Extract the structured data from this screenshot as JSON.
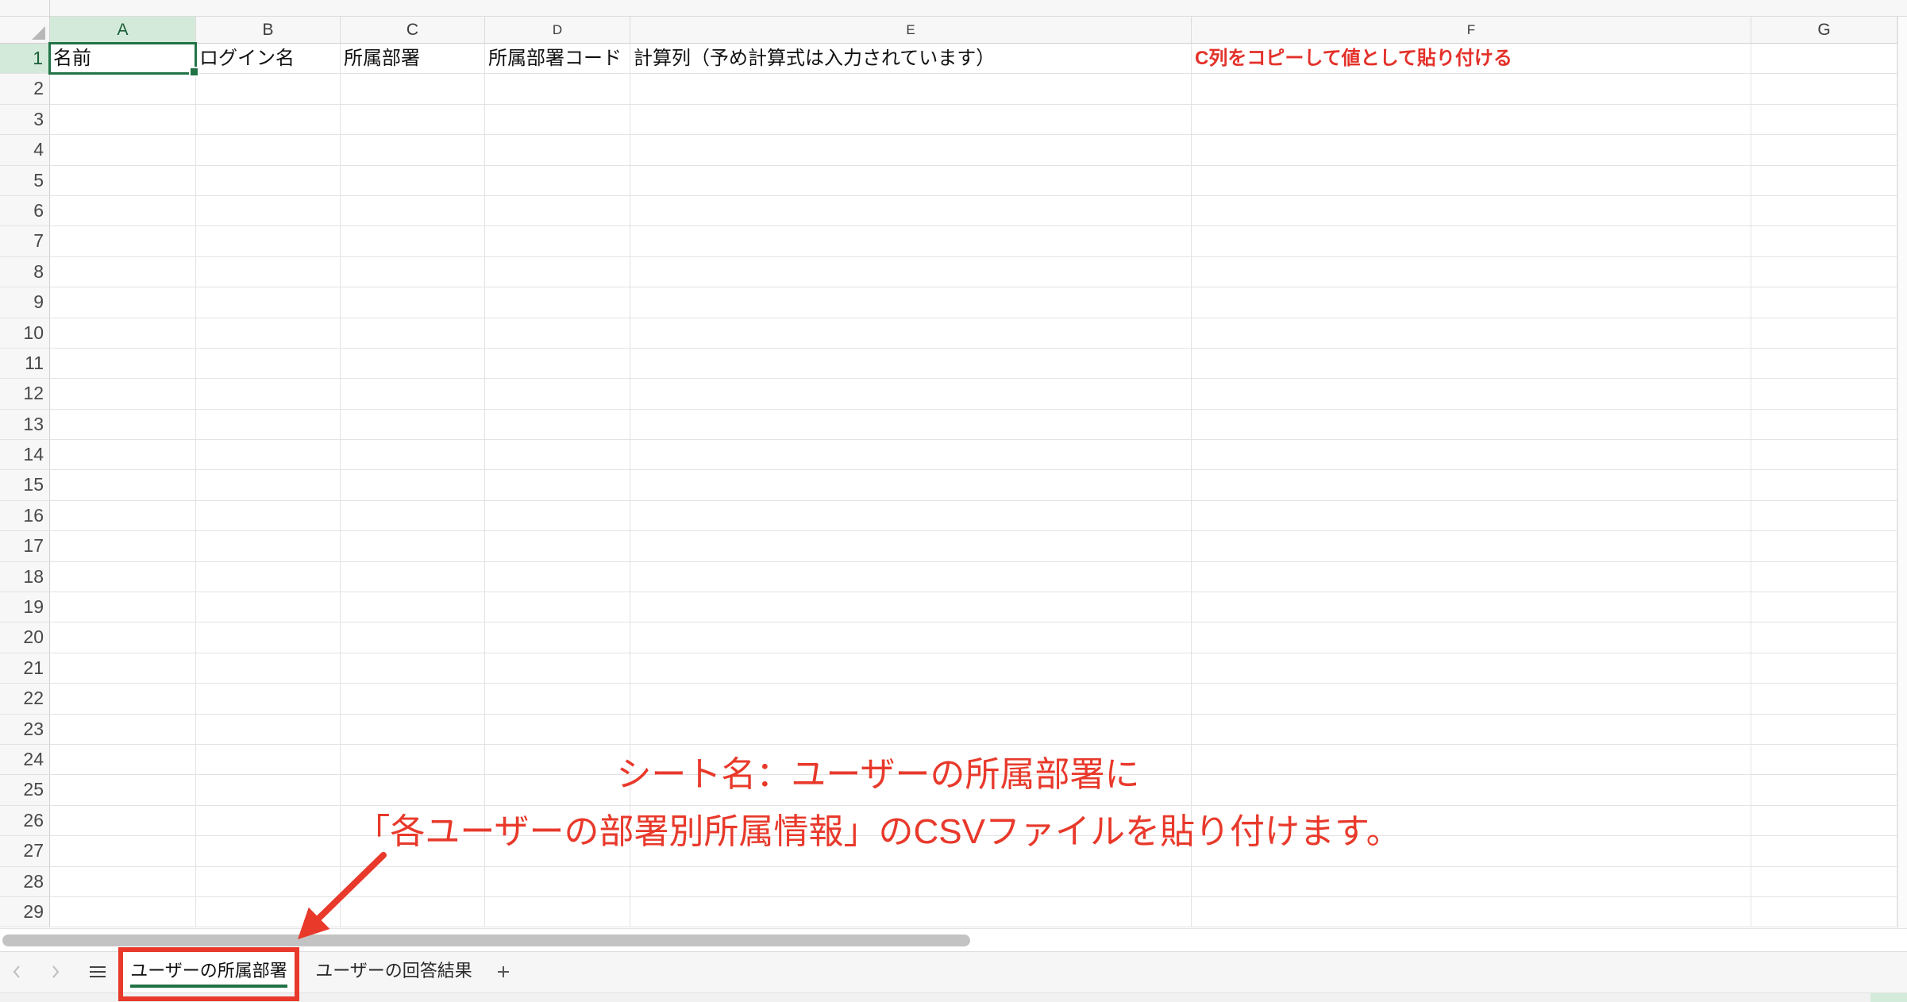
{
  "colors": {
    "accent": "#217346",
    "selection_bg": "#d3eadb",
    "annotation": "#e8392b",
    "grid_line": "#e3e3e3"
  },
  "sheet": {
    "columns": [
      "A",
      "B",
      "C",
      "D",
      "E",
      "F",
      "G"
    ],
    "rows": [
      1,
      2,
      3,
      4,
      5,
      6,
      7,
      8,
      9,
      10,
      11,
      12,
      13,
      14,
      15,
      16,
      17,
      18,
      19,
      20,
      21,
      22,
      23,
      24,
      25,
      26,
      27,
      28,
      29
    ],
    "selection": {
      "column": "A",
      "row": 1
    },
    "cells": {
      "A1": "名前",
      "B1": "ログイン名",
      "C1": "所属部署",
      "D1": "所属部署コード",
      "E1": "計算列（予め計算式は入力されています）",
      "F1": "C列をコピーして値として貼り付ける"
    },
    "cell_styles": {
      "F1": {
        "color": "#e3312a",
        "bold": true
      }
    }
  },
  "sheet_nav": {
    "prev_icon": "chevron-left-icon",
    "next_icon": "chevron-right-icon",
    "list_icon": "menu-icon",
    "add_icon": "plus-icon"
  },
  "tabs": [
    {
      "label": "ユーザーの所属部署",
      "active": true
    },
    {
      "label": "ユーザーの回答結果",
      "active": false
    }
  ],
  "annotation": {
    "lines": [
      "シート名：ユーザーの所属部署に",
      "「各ユーザーの部署別所属情報」のCSVファイルを貼り付けます。"
    ]
  }
}
